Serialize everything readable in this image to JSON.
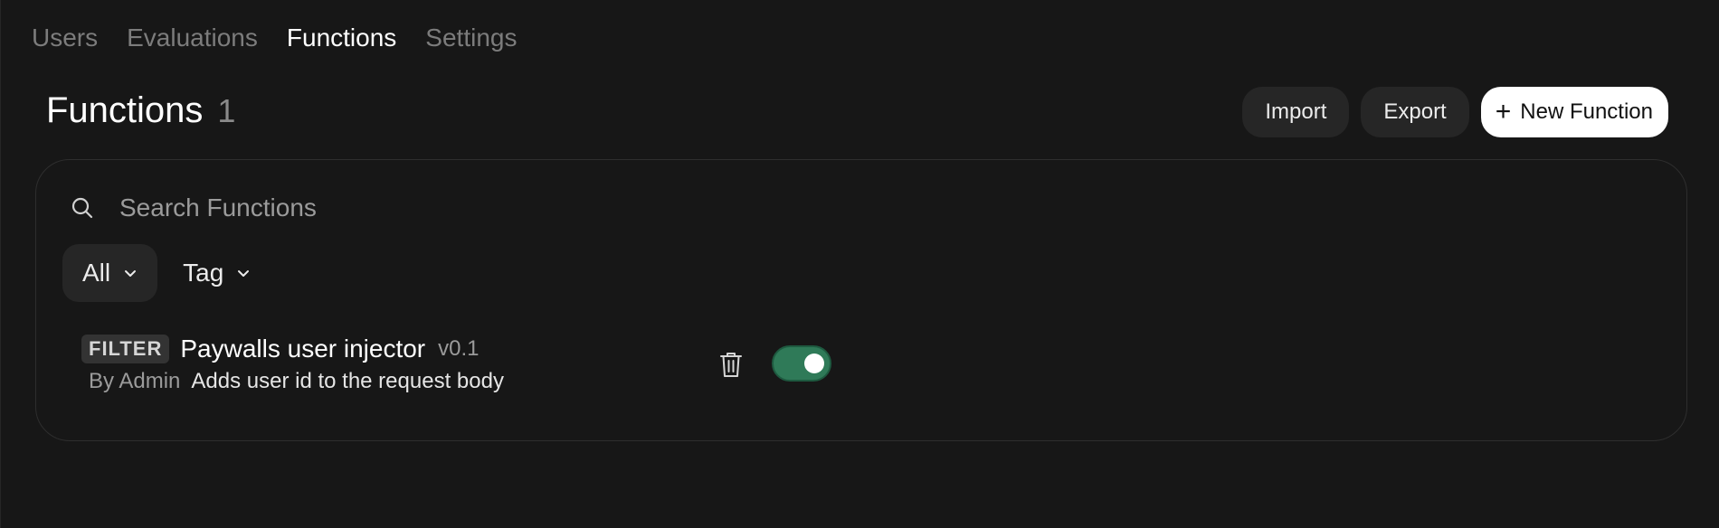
{
  "tabs": [
    {
      "label": "Users",
      "active": false
    },
    {
      "label": "Evaluations",
      "active": false
    },
    {
      "label": "Functions",
      "active": true
    },
    {
      "label": "Settings",
      "active": false
    }
  ],
  "header": {
    "title": "Functions",
    "count": "1"
  },
  "actions": {
    "import_label": "Import",
    "export_label": "Export",
    "new_label": "New Function"
  },
  "search": {
    "placeholder": "Search Functions",
    "value": ""
  },
  "filters": {
    "scope_label": "All",
    "tag_label": "Tag"
  },
  "functions": [
    {
      "type": "FILTER",
      "name": "Paywalls user injector",
      "version": "v0.1",
      "author": "By Admin",
      "description": "Adds user id to the request body",
      "enabled": true
    }
  ],
  "colors": {
    "background": "#171717",
    "toggle_on": "#2f7a58",
    "primary_button": "#ffffff"
  }
}
